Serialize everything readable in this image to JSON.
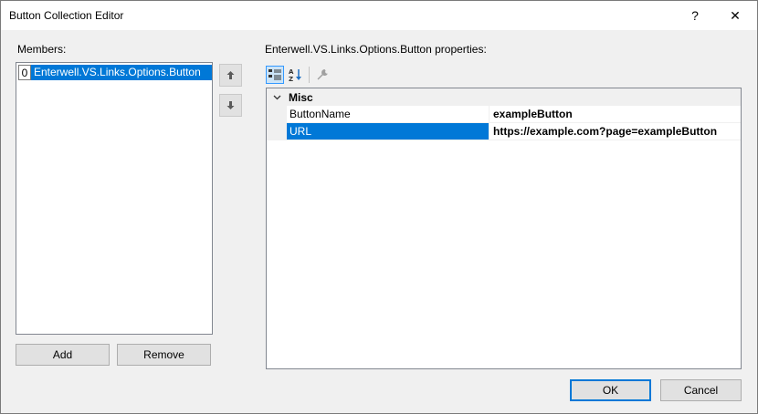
{
  "window": {
    "title": "Button Collection Editor",
    "help_glyph": "?",
    "close_glyph": "✕"
  },
  "members": {
    "label": "Members:",
    "items": [
      {
        "index": "0",
        "text": "Enterwell.VS.Links.Options.Button",
        "selected": true
      }
    ],
    "move_up_icon": "arrow-up-icon",
    "move_down_icon": "arrow-down-icon",
    "add_label": "Add",
    "remove_label": "Remove"
  },
  "properties": {
    "label": "Enterwell.VS.Links.Options.Button properties:",
    "toolbar": {
      "categorized_icon": "categorized-icon",
      "alphabetical_icon": "alphabetical-sort-icon",
      "property_pages_icon": "wrench-icon"
    },
    "category": {
      "name": "Misc",
      "expanded": true
    },
    "rows": [
      {
        "name": "ButtonName",
        "value": "exampleButton",
        "selected": false
      },
      {
        "name": "URL",
        "value": "https://example.com?page=exampleButton",
        "selected": true
      }
    ]
  },
  "footer": {
    "ok_label": "OK",
    "cancel_label": "Cancel"
  },
  "colors": {
    "selection": "#0078d7",
    "default_button_border": "#0078d7",
    "background": "#f0f0f0"
  }
}
